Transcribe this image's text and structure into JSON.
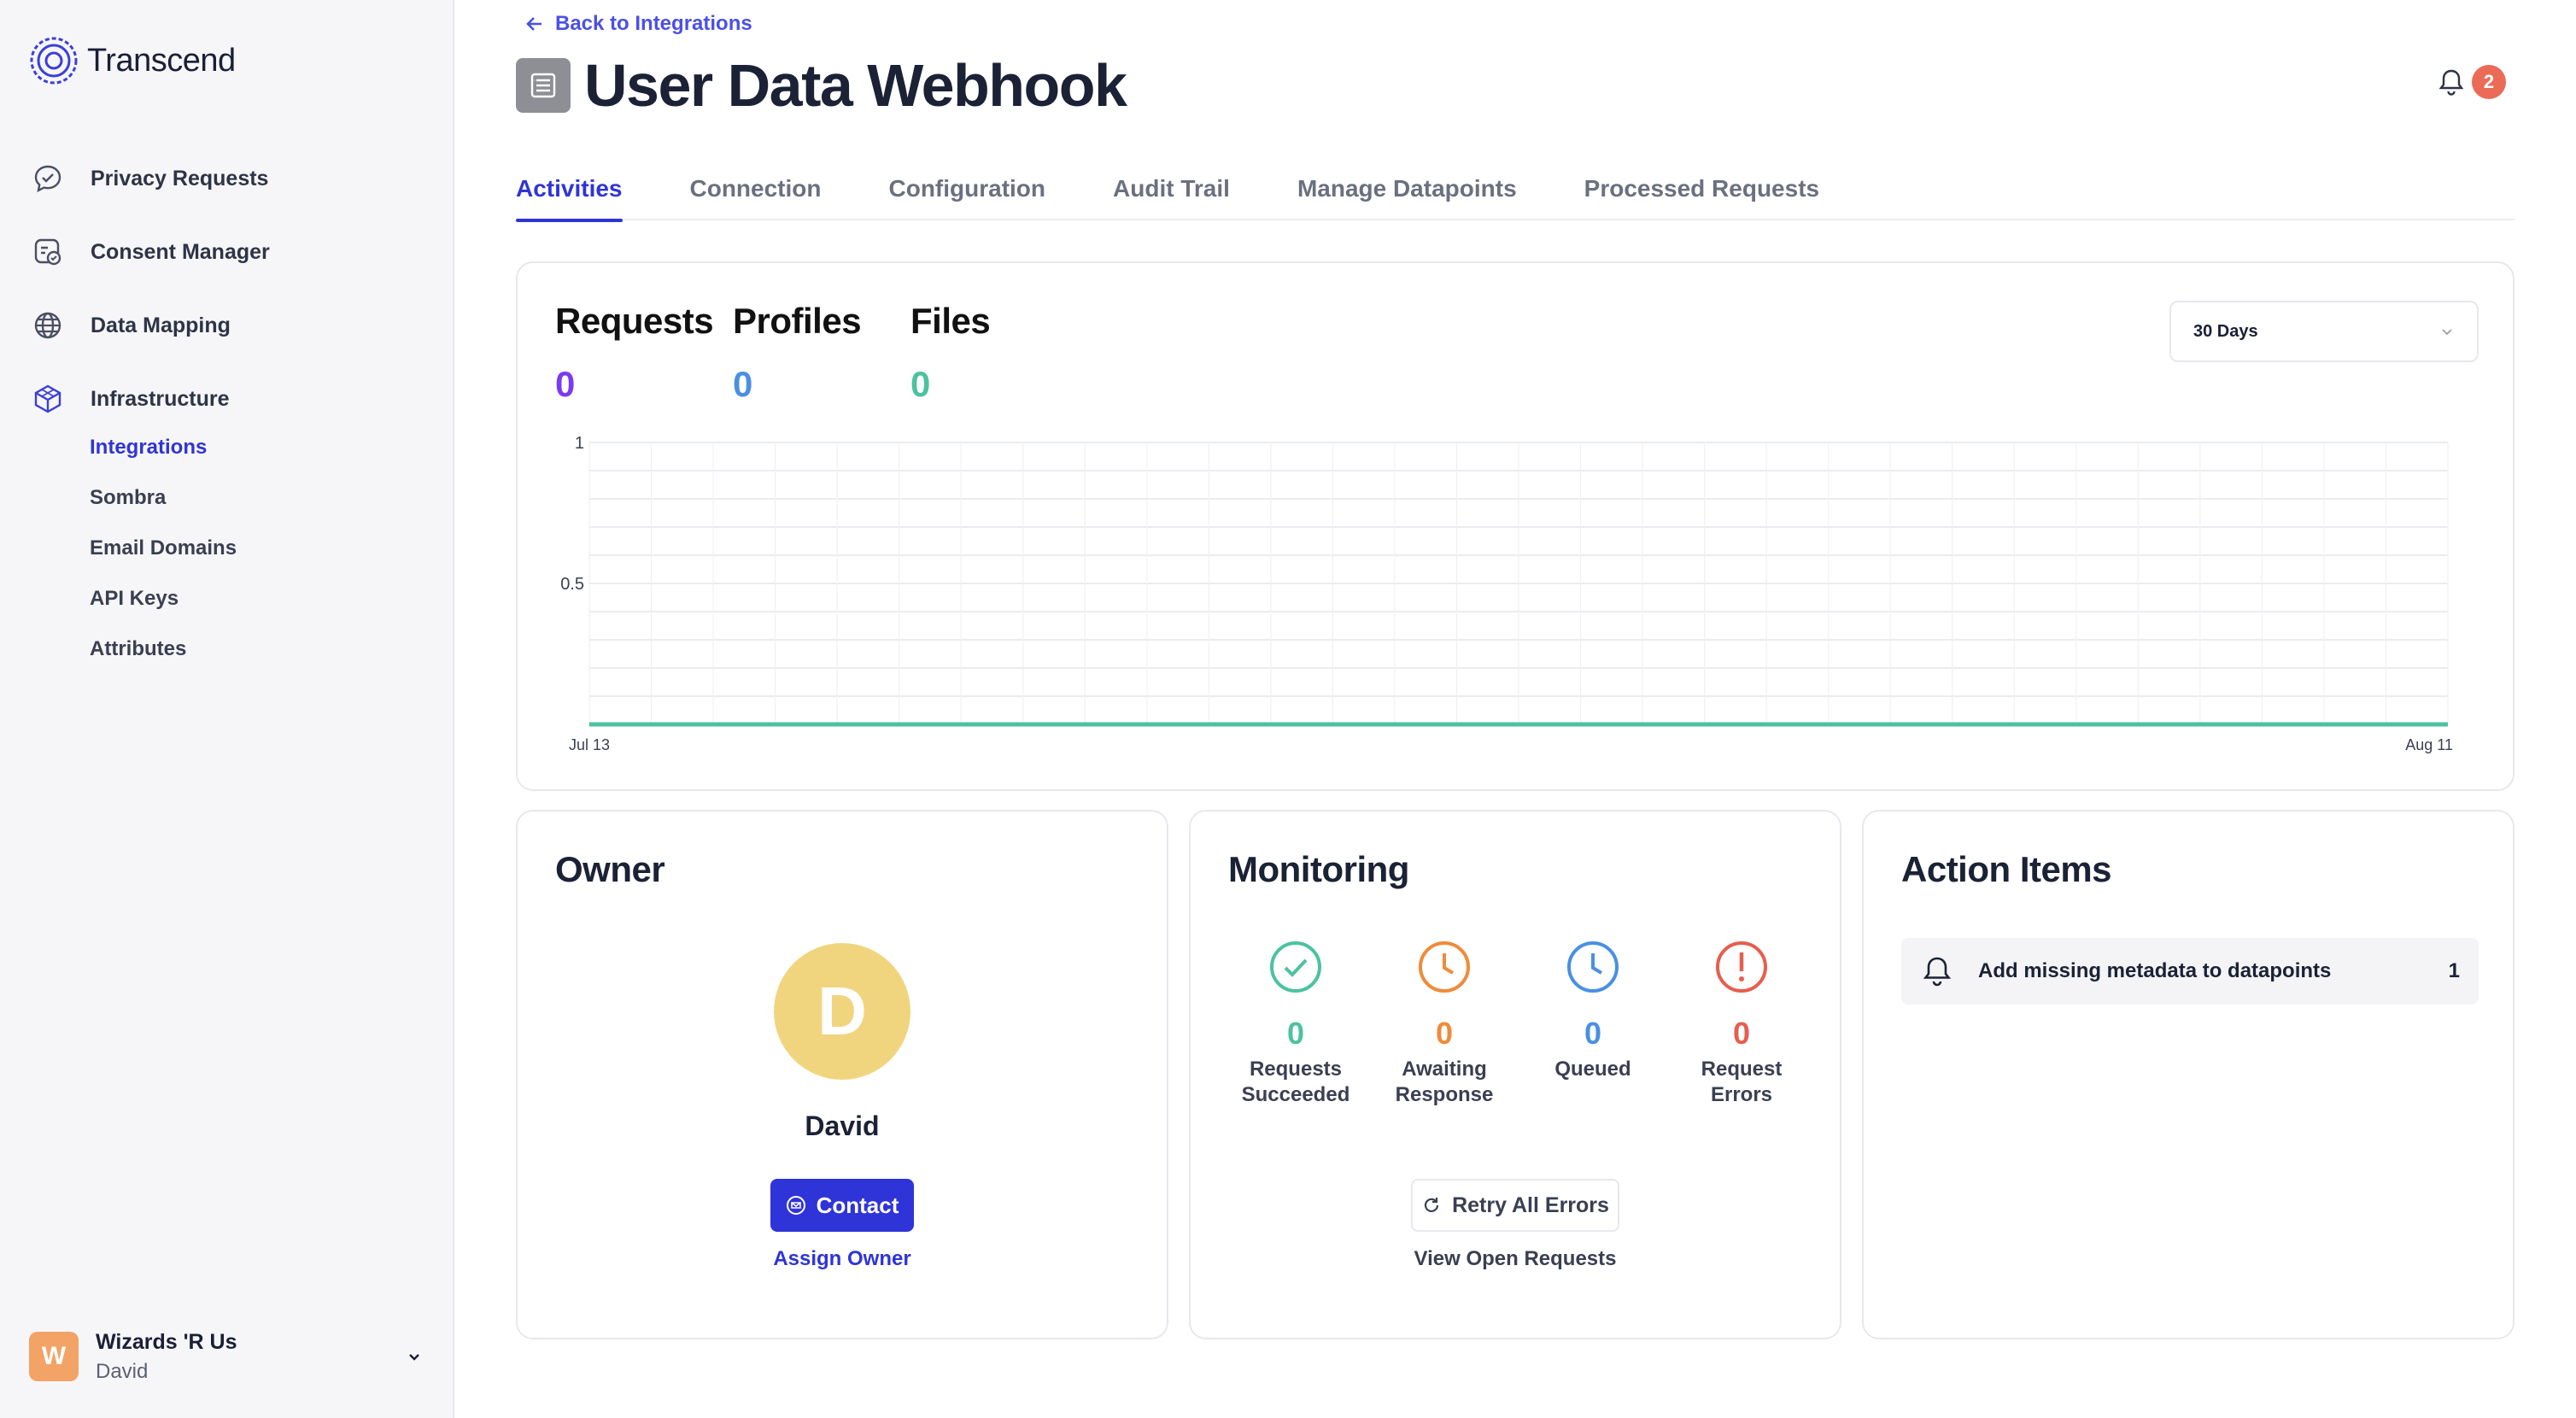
{
  "brand": {
    "name": "Transcend"
  },
  "sidebar": {
    "items": [
      {
        "label": "Privacy Requests",
        "icon": "chat-check-icon"
      },
      {
        "label": "Consent Manager",
        "icon": "consent-icon"
      },
      {
        "label": "Data Mapping",
        "icon": "globe-icon"
      },
      {
        "label": "Infrastructure",
        "icon": "cube-icon"
      }
    ],
    "subitems": [
      {
        "label": "Integrations",
        "active": true
      },
      {
        "label": "Sombra"
      },
      {
        "label": "Email Domains"
      },
      {
        "label": "API Keys"
      },
      {
        "label": "Attributes"
      }
    ],
    "account": {
      "initial": "W",
      "org": "Wizards 'R Us",
      "user": "David"
    }
  },
  "header": {
    "back_label": "Back to Integrations",
    "title": "User Data Webhook",
    "notification_count": "2"
  },
  "tabs": [
    "Activities",
    "Connection",
    "Configuration",
    "Audit Trail",
    "Manage Datapoints",
    "Processed Requests"
  ],
  "activity": {
    "stats": [
      {
        "label": "Requests",
        "value": "0",
        "color": "#7a3bf0"
      },
      {
        "label": "Profiles",
        "value": "0",
        "color": "#4a90e2"
      },
      {
        "label": "Files",
        "value": "0",
        "color": "#4cc2a0"
      }
    ],
    "range_select": "30 Days"
  },
  "chart_data": {
    "type": "line",
    "x": [
      "Jul 13",
      "Aug 11"
    ],
    "xlabels": [
      "Jul 13",
      "Aug 11"
    ],
    "yticks": [
      "1",
      "0.5"
    ],
    "ylim": [
      0,
      1
    ],
    "series": [
      {
        "values": [
          0,
          0
        ],
        "color": "#4cc2a0"
      }
    ],
    "grid": true
  },
  "owner": {
    "title": "Owner",
    "initial": "D",
    "name": "David",
    "contact_label": "Contact",
    "assign_label": "Assign Owner"
  },
  "monitoring": {
    "title": "Monitoring",
    "items": [
      {
        "value": "0",
        "label": "Requests Succeeded",
        "color": "#4cc2a0",
        "icon": "check-circle-icon"
      },
      {
        "value": "0",
        "label": "Awaiting Response",
        "color": "#ef8b3a",
        "icon": "clock-icon"
      },
      {
        "value": "0",
        "label": "Queued",
        "color": "#4a90e2",
        "icon": "clock-icon"
      },
      {
        "value": "0",
        "label": "Request Errors",
        "color": "#e65e4d",
        "icon": "alert-circle-icon"
      }
    ],
    "retry_label": "Retry All Errors",
    "view_open_label": "View Open Requests"
  },
  "action_items": {
    "title": "Action Items",
    "items": [
      {
        "label": "Add missing metadata to datapoints",
        "count": "1"
      }
    ]
  }
}
